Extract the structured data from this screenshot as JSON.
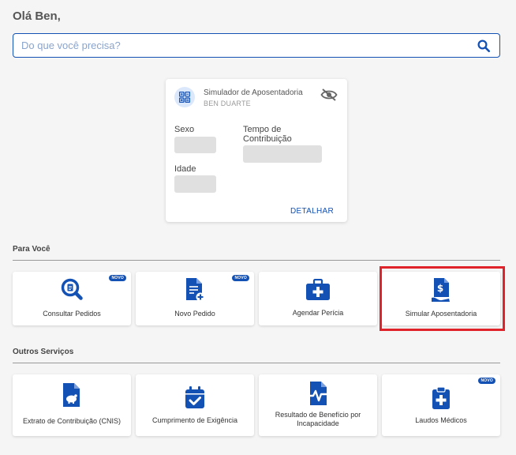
{
  "greeting": "Olá Ben,",
  "search": {
    "placeholder": "Do que você precisa?"
  },
  "simulator_card": {
    "title": "Simulador de Aposentadoria",
    "user": "BEN DUARTE",
    "sex_label": "Sexo",
    "time_label": "Tempo de Contribuição",
    "age_label": "Idade",
    "detail_label": "DETALHAR"
  },
  "sections": {
    "for_you": {
      "title": "Para Você",
      "items": [
        {
          "label": "Consultar Pedidos",
          "badge": "NOVO",
          "icon": "search-document-icon"
        },
        {
          "label": "Novo Pedido",
          "badge": "NOVO",
          "icon": "new-document-icon"
        },
        {
          "label": "Agendar Perícia",
          "badge": "",
          "icon": "medical-kit-icon"
        },
        {
          "label": "Simular Aposentadoria",
          "badge": "",
          "icon": "money-document-icon"
        }
      ]
    },
    "other_services": {
      "title": "Outros Serviços",
      "items": [
        {
          "label": "Extrato de Contribuição (CNIS)",
          "badge": "",
          "icon": "piggy-document-icon"
        },
        {
          "label": "Cumprimento de Exigência",
          "badge": "",
          "icon": "calendar-check-icon"
        },
        {
          "label": "Resultado de Benefício por Incapacidade",
          "badge": "",
          "icon": "heartbeat-document-icon"
        },
        {
          "label": "Laudos Médicos",
          "badge": "NOVO",
          "icon": "clipboard-medical-icon"
        }
      ]
    }
  },
  "colors": {
    "primary": "#1351b4",
    "highlight": "#e0222a",
    "background": "#f5f5f5"
  }
}
